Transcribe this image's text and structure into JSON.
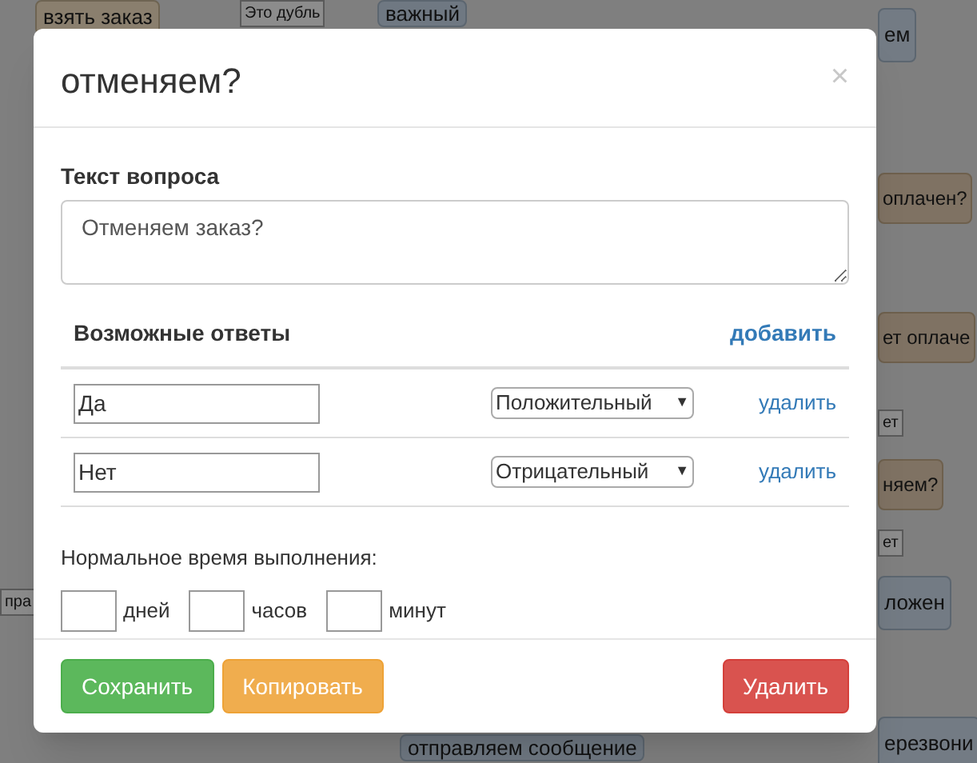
{
  "canvas": {
    "nodes": [
      {
        "text": "взять заказ",
        "kind": "person"
      },
      {
        "text": "Это дубль",
        "kind": "tag"
      },
      {
        "text": "важный",
        "kind": "check"
      },
      {
        "text": "ем",
        "kind": "node"
      },
      {
        "text": "оплачен?",
        "kind": "question"
      },
      {
        "text": "ет оплаче",
        "kind": "question"
      },
      {
        "text": "ет",
        "kind": "tag"
      },
      {
        "text": "няем?",
        "kind": "question"
      },
      {
        "text": "ет",
        "kind": "tag"
      },
      {
        "text": "ложен",
        "kind": "node"
      },
      {
        "text": "ерезвони",
        "kind": "node"
      },
      {
        "text": "отправляем сообщение",
        "kind": "check"
      },
      {
        "text": "пра",
        "kind": "tag"
      }
    ]
  },
  "modal": {
    "title": "отменяем?",
    "close": "×",
    "question_label": "Текст вопроса",
    "question_value": "Отменяем заказ?",
    "answers_label": "Возможные ответы",
    "add_link": "добавить",
    "answers": [
      {
        "value": "Да",
        "type": "Положительный",
        "caret": "▼",
        "delete": "удалить"
      },
      {
        "value": "Нет",
        "type": "Отрицательный",
        "caret": "▼",
        "delete": "удалить"
      }
    ],
    "time_label": "Нормальное время выполнения:",
    "time_fields": [
      {
        "unit": "дней"
      },
      {
        "unit": "часов"
      },
      {
        "unit": "минут"
      }
    ],
    "buttons": [
      {
        "label": "Сохранить",
        "kind": "success"
      },
      {
        "label": "Копировать",
        "kind": "warning"
      },
      {
        "label": "Удалить",
        "kind": "danger"
      }
    ]
  }
}
